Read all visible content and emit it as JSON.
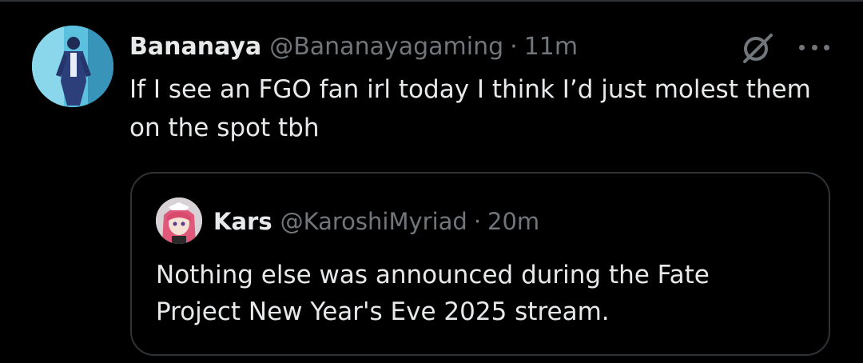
{
  "tweet": {
    "author_name": "Bananaya",
    "author_handle": "@Bananayagaming",
    "separator": "·",
    "time": "11m",
    "text": "If I see an FGO fan irl today I think I’d just molest them on the spot tbh"
  },
  "quoted_tweet": {
    "author_name": "Kars",
    "author_handle": "@KaroshiMyriad",
    "separator": "·",
    "time": "20m",
    "text": "Nothing else was announced during the Fate Project New Year's Eve 2025 stream."
  },
  "icons": {
    "grok": "grok-icon",
    "more": "more-icon"
  },
  "colors": {
    "background": "#000000",
    "primary_text": "#e7e9ea",
    "secondary_text": "#71767b",
    "border": "#2f3336"
  }
}
